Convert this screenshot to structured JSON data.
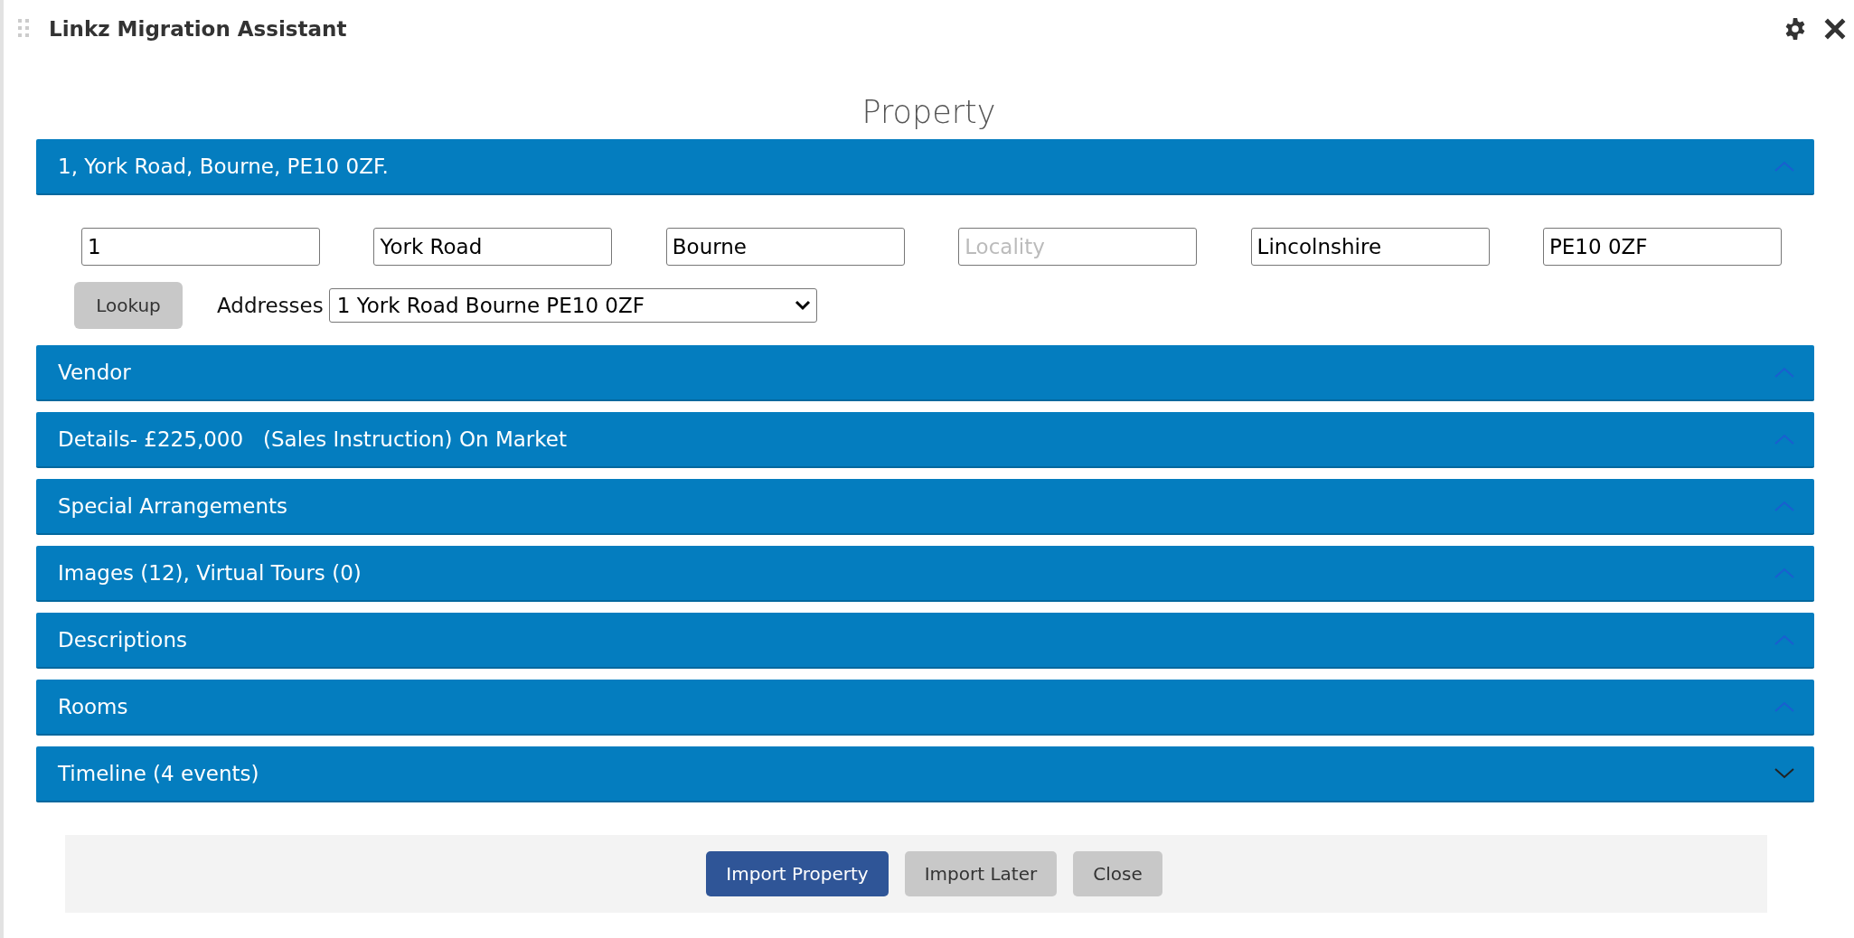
{
  "window": {
    "title": "Linkz Migration Assistant"
  },
  "heading": "Property",
  "sections": [
    {
      "title": "1, York Road, Bourne, PE10 0ZF.",
      "expanded": true
    },
    {
      "title": "Vendor",
      "expanded": true
    },
    {
      "title": "Details- £225,000   (Sales Instruction) On Market",
      "expanded": true
    },
    {
      "title": "Special Arrangements",
      "expanded": true
    },
    {
      "title": "Images (12), Virtual Tours (0)",
      "expanded": true
    },
    {
      "title": "Descriptions",
      "expanded": true
    },
    {
      "title": "Rooms",
      "expanded": true
    },
    {
      "title": "Timeline (4 events)",
      "expanded": false
    }
  ],
  "address_fields": [
    {
      "value": "1"
    },
    {
      "value": "York Road"
    },
    {
      "value": "Bourne"
    },
    {
      "placeholder": "Locality"
    },
    {
      "value": "Lincolnshire"
    },
    {
      "value": "PE10 0ZF"
    }
  ],
  "lookup_button": "Lookup",
  "addresses": {
    "label": "Addresses",
    "value": "1 York Road Bourne PE10 0ZF"
  },
  "buttons": [
    {
      "label": "Import Property",
      "kind": "primary"
    },
    {
      "label": "Import Later",
      "kind": "secondary"
    },
    {
      "label": "Close",
      "kind": "secondary"
    }
  ]
}
